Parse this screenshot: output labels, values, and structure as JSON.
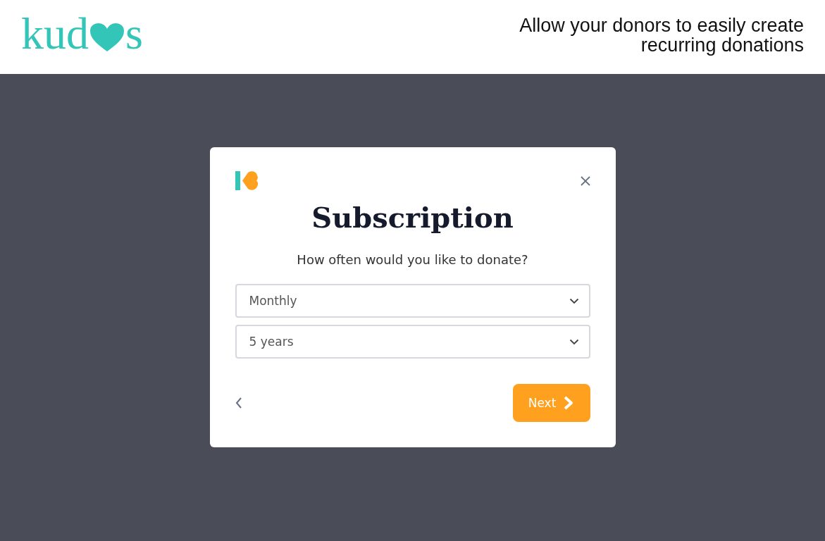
{
  "header": {
    "logo": {
      "before": "kud",
      "after": "s"
    },
    "tagline": "Allow your donors to easily create recurring donations"
  },
  "modal": {
    "title": "Subscription",
    "question": "How often would you like to donate?",
    "selects": [
      {
        "value": "Monthly"
      },
      {
        "value": "5 years"
      }
    ],
    "next_button": "Next"
  }
}
